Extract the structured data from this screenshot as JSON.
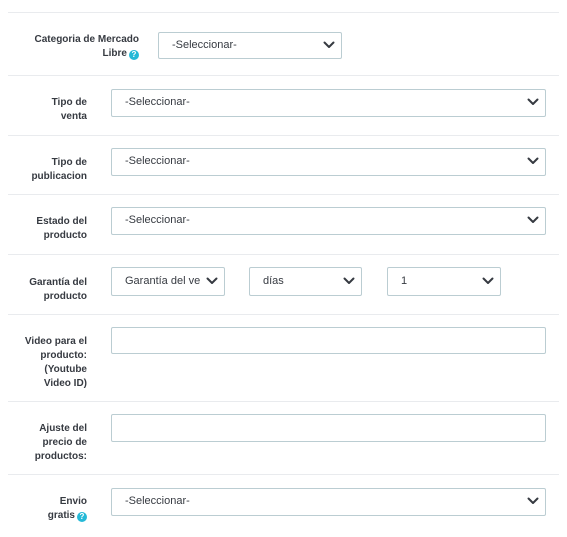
{
  "fields": {
    "categoria": {
      "label_lines": [
        "Categoria de Mercado",
        "Libre"
      ],
      "has_help": true,
      "value": "-Seleccionar-"
    },
    "tipo_venta": {
      "label_lines": [
        "Tipo de",
        "venta"
      ],
      "value": "-Seleccionar-"
    },
    "tipo_publicacion": {
      "label_lines": [
        "Tipo de",
        "publicacion"
      ],
      "value": "-Seleccionar-"
    },
    "estado_producto": {
      "label_lines": [
        "Estado del",
        "producto"
      ],
      "value": "-Seleccionar-"
    },
    "garantia": {
      "label_lines": [
        "Garantía del",
        "producto"
      ],
      "type_value": "Garantía del ve",
      "unit_value": "días",
      "amount_value": "1"
    },
    "video": {
      "label_lines": [
        "Video para el",
        "producto:",
        "(Youtube",
        "Video ID)"
      ],
      "value": ""
    },
    "ajuste_precio": {
      "label_lines": [
        "Ajuste del",
        "precio de",
        "productos:"
      ],
      "value": ""
    },
    "envio_gratis": {
      "label_lines": [
        "Envio",
        "gratis"
      ],
      "has_help": true,
      "value": "-Seleccionar-"
    }
  },
  "help_icon_glyph": "?",
  "icons": {
    "help": "question-circle-icon",
    "dropdown": "chevron-down-icon"
  },
  "colors": {
    "help": "#25b9d7",
    "border": "#bbcdd2",
    "text": "#363a41"
  }
}
